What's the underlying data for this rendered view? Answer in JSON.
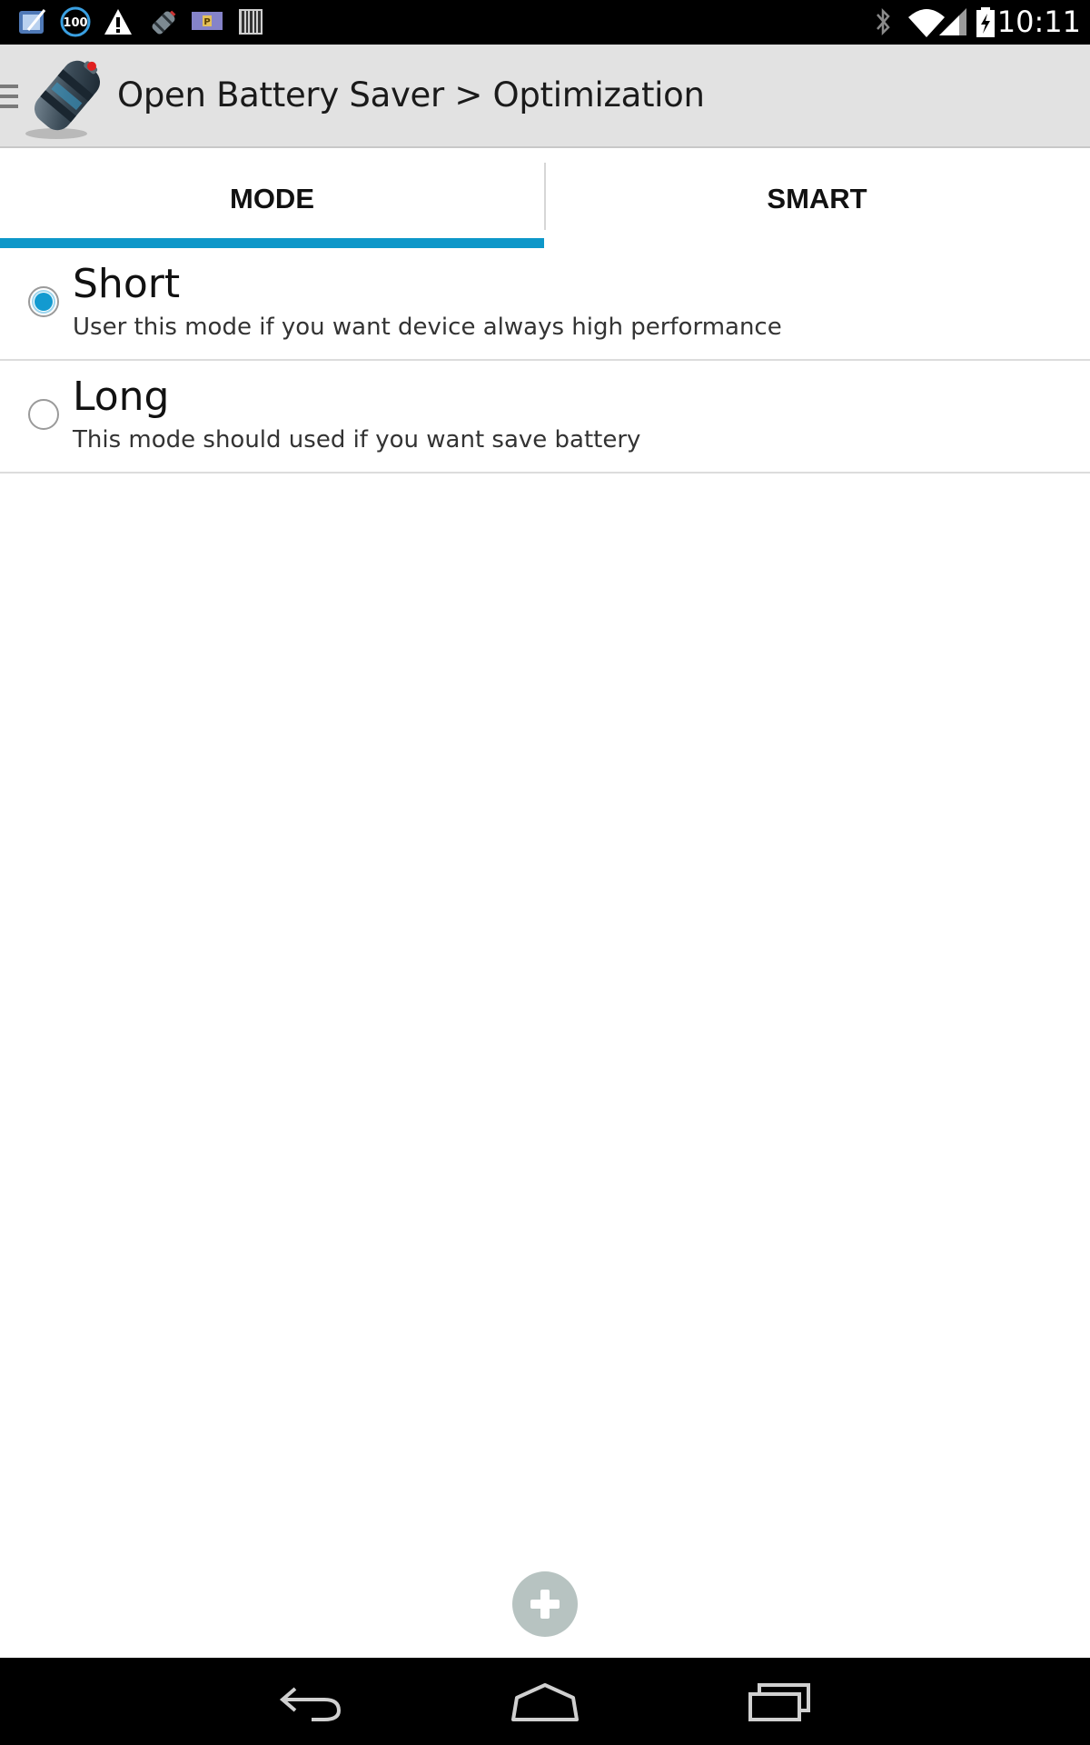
{
  "status_bar": {
    "time": "10:11",
    "notification_badge": "100",
    "icons": [
      "app-notification-icon",
      "battery-100-icon",
      "warning-icon",
      "battery-saver-icon",
      "parking-card-icon",
      "barcode-icon",
      "bluetooth-icon",
      "wifi-icon",
      "cell-signal-icon",
      "battery-icon"
    ]
  },
  "action_bar": {
    "title": "Open Battery Saver > Optimization",
    "icons": [
      "drawer-icon",
      "app-logo-battery-icon"
    ]
  },
  "tabs": [
    {
      "label": "MODE",
      "selected": true
    },
    {
      "label": "SMART",
      "selected": false
    }
  ],
  "modes": [
    {
      "title": "Short",
      "subtitle": "User this mode if you want device always high performance",
      "selected": true
    },
    {
      "title": "Long",
      "subtitle": "This mode should used if you want save battery",
      "selected": false
    }
  ],
  "add_button": {
    "icon": "plus-icon"
  },
  "nav_bar": {
    "icons": [
      "back-icon",
      "home-icon",
      "recents-icon"
    ]
  },
  "colors": {
    "accent": "#0e97c9",
    "action_bar": "#e2e2e2",
    "system_bars": "#000000",
    "add_button": "#b7c3c1"
  }
}
